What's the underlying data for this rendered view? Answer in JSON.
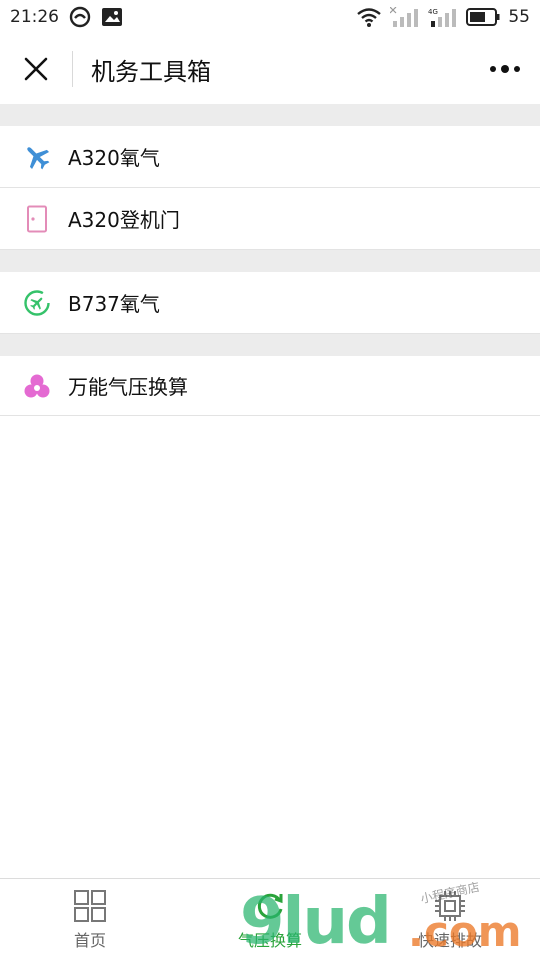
{
  "status_bar": {
    "time": "21:26",
    "battery": "55"
  },
  "nav": {
    "title": "机务工具箱"
  },
  "list": {
    "items": [
      {
        "label": "A320氧气",
        "icon": "airplane-icon",
        "color": "#3f8fd6"
      },
      {
        "label": "A320登机门",
        "icon": "door-icon",
        "color": "#e38cb8"
      },
      {
        "label": "B737氧气",
        "icon": "airplane-circle-icon",
        "color": "#35c26a"
      },
      {
        "label": "万能气压换算",
        "icon": "three-circles-icon",
        "color": "#e46ad2"
      }
    ]
  },
  "tab_bar": {
    "tabs": [
      {
        "label": "首页",
        "icon": "grid-icon",
        "active": false
      },
      {
        "label": "气压换算",
        "icon": "refresh-icon",
        "active": true
      },
      {
        "label": "快速排故",
        "icon": "chip-icon",
        "active": false
      }
    ],
    "active_color": "#2aa33b"
  },
  "watermark": {
    "main": "9lud",
    "suffix": ".com",
    "small": "小程序商店"
  }
}
